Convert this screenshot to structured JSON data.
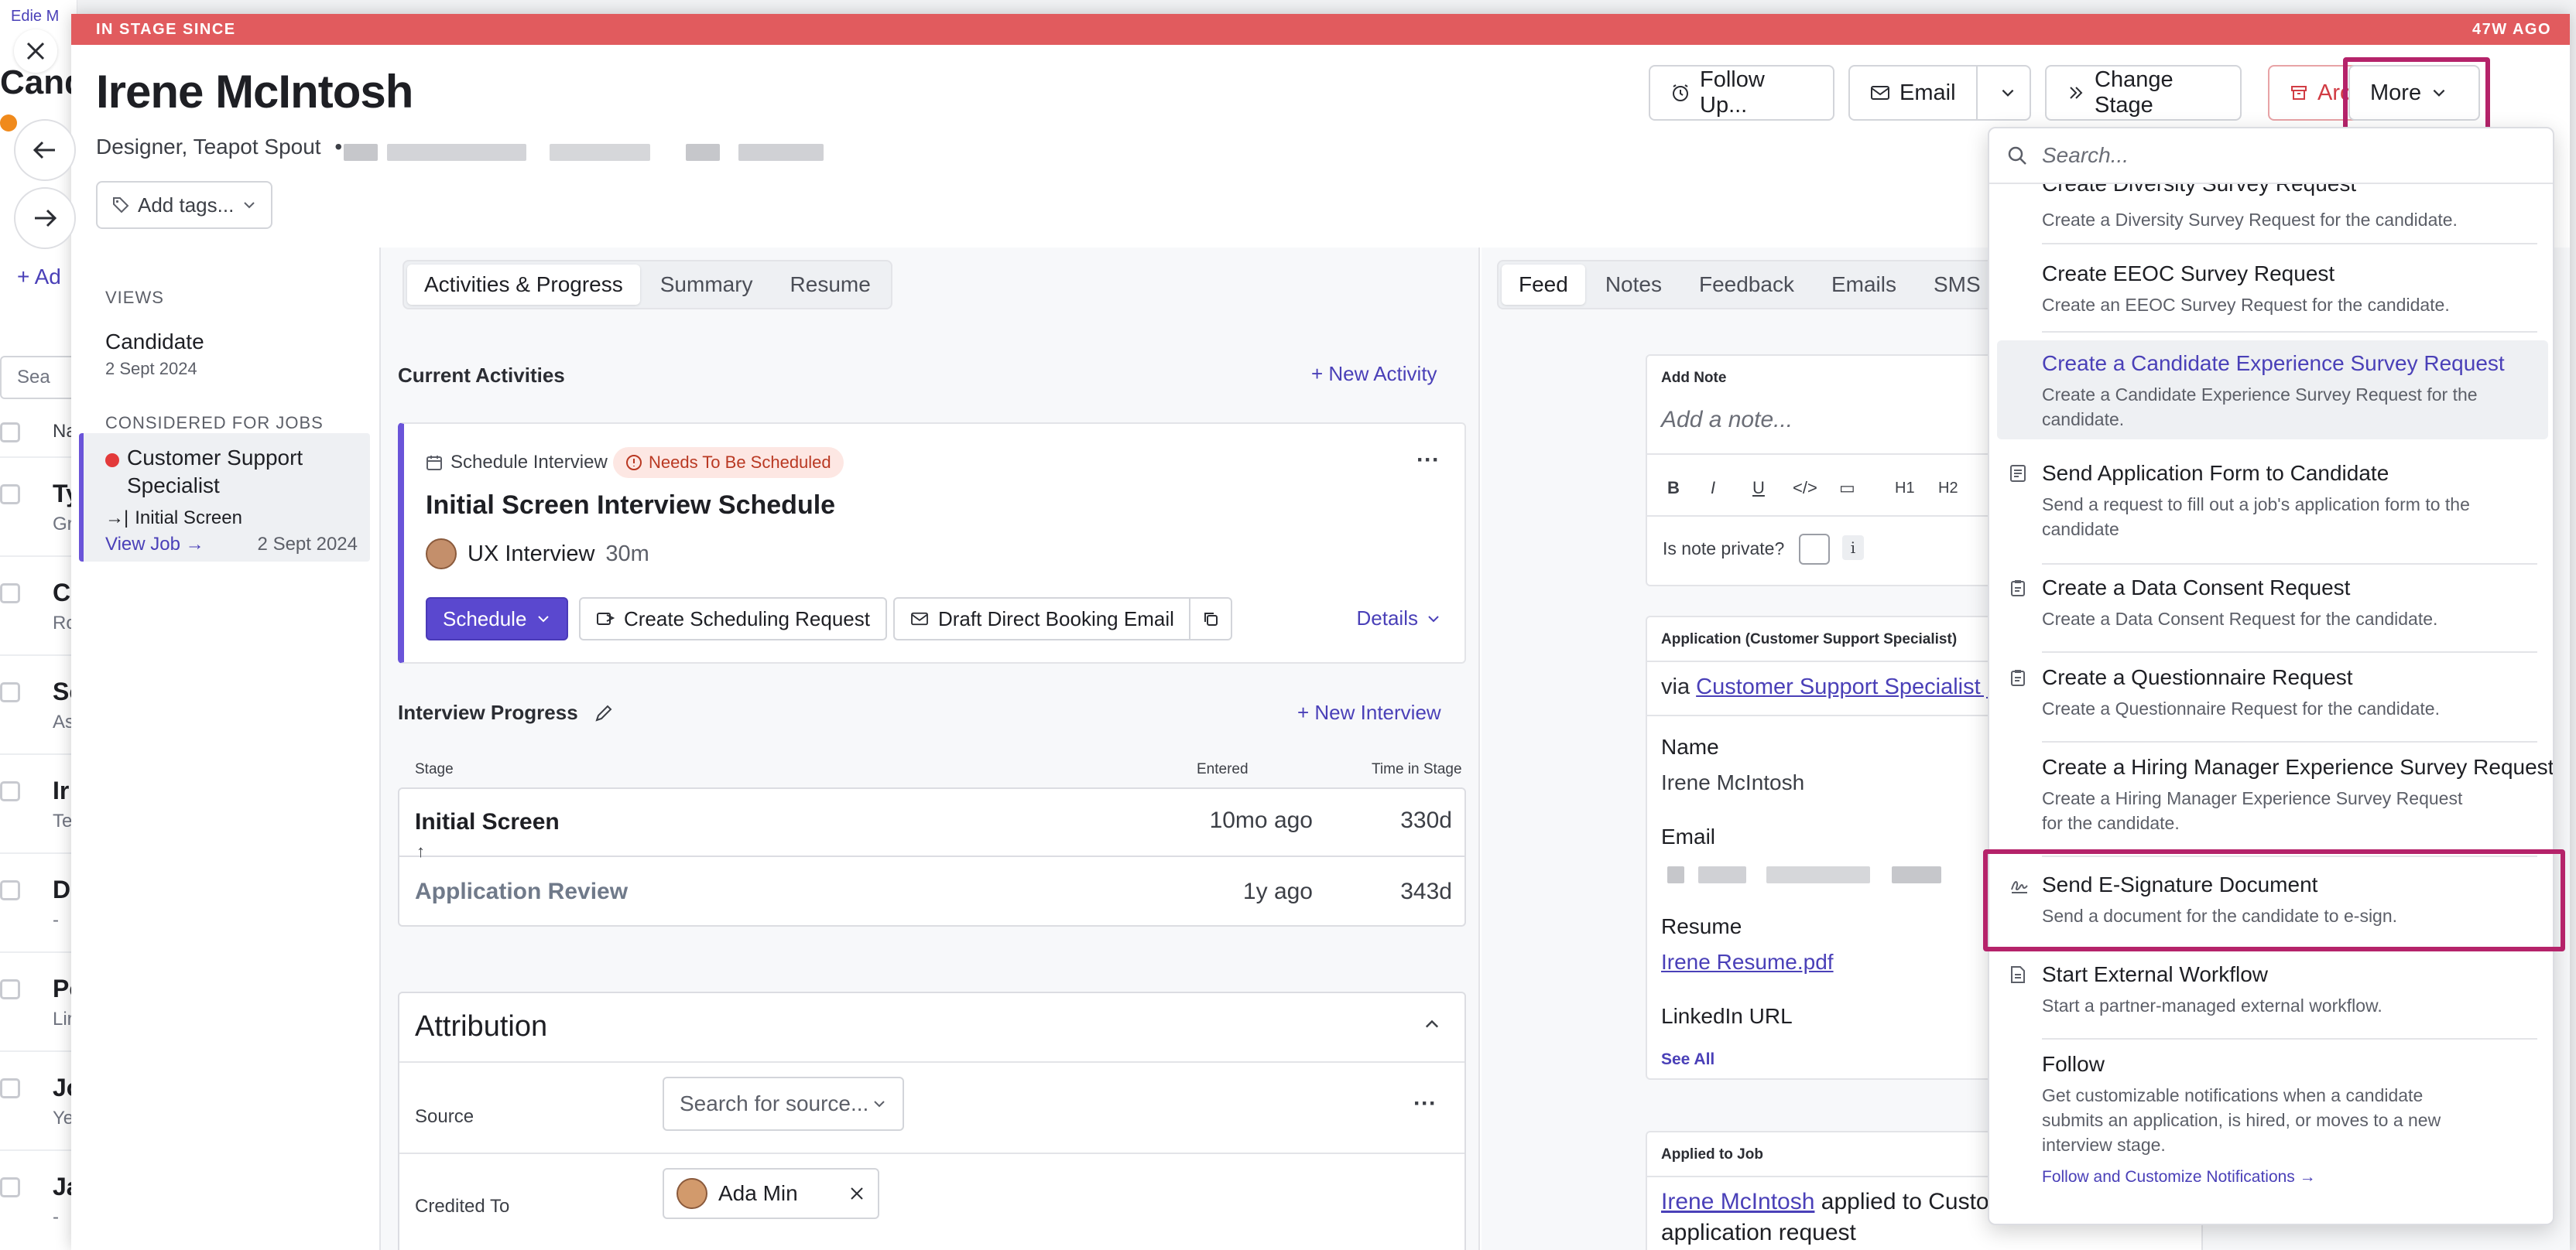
{
  "background": {
    "top_link": "Edie M",
    "header_fragment": "Cand",
    "add_label": "+ Ad",
    "search_fragment": "Sea",
    "col_fragment": "Na",
    "rows": [
      {
        "letter": "Ty",
        "sub": "Gr"
      },
      {
        "letter": "C",
        "sub": "Ro"
      },
      {
        "letter": "Sc",
        "sub": "As"
      },
      {
        "letter": "Ir",
        "sub": "Te"
      },
      {
        "letter": "D",
        "sub": "-"
      },
      {
        "letter": "Pe",
        "sub": "Lir"
      },
      {
        "letter": "Jo",
        "sub": "Ye"
      },
      {
        "letter": "Ja",
        "sub": "-"
      }
    ]
  },
  "stage_bar": {
    "left": "IN STAGE SINCE",
    "right": "47W AGO"
  },
  "candidate": {
    "name": "Irene McIntosh",
    "title": "Designer, Teapot Spout",
    "bullet": "•",
    "add_tags": "Add tags..."
  },
  "header_buttons": {
    "follow_up": "Follow Up...",
    "email": "Email",
    "change_stage": "Change Stage",
    "archive": "Archive",
    "more": "More"
  },
  "views": {
    "heading": "VIEWS",
    "candidate": "Candidate",
    "candidate_date": "2 Sept 2024",
    "considered_heading": "CONSIDERED FOR JOBS",
    "job_title_line1": "Customer Support",
    "job_title_line2": "Specialist",
    "job_stage": "Initial Screen",
    "view_job": "View Job →",
    "job_date": "2 Sept 2024"
  },
  "middle": {
    "tabs": [
      "Activities & Progress",
      "Summary",
      "Resume"
    ],
    "current_activities": "Current Activities",
    "new_activity": "+ New Activity",
    "activity": {
      "type": "Schedule Interview",
      "status": "Needs To Be Scheduled",
      "title": "Initial Screen Interview Schedule",
      "interview_name": "UX Interview",
      "duration": "30m",
      "schedule": "Schedule",
      "create_request": "Create Scheduling Request",
      "draft_email": "Draft Direct Booking Email",
      "details": "Details",
      "more": "···"
    },
    "progress": {
      "title": "Interview Progress",
      "new_interview": "+ New Interview",
      "headers": {
        "stage": "Stage",
        "entered": "Entered",
        "time": "Time in Stage"
      },
      "rows": [
        {
          "stage": "Initial Screen",
          "entered": "10mo ago",
          "time": "330d"
        },
        {
          "stage": "Application Review",
          "entered": "1y ago",
          "time": "343d"
        }
      ]
    },
    "attribution": {
      "title": "Attribution",
      "source_label": "Source",
      "source_placeholder": "Search for source...",
      "credited_label": "Credited To",
      "credited_name": "Ada Min",
      "more": "···"
    }
  },
  "feed": {
    "tabs": [
      "Feed",
      "Notes",
      "Feedback",
      "Emails",
      "SMS"
    ],
    "add_note_label": "Add Note",
    "add_note_placeholder": "Add a note...",
    "format_buttons": [
      "B",
      "I",
      "U",
      "</>",
      "▭",
      "H1",
      "H2"
    ],
    "private_label": "Is note private?",
    "info": "i",
    "application": {
      "title": "Application (Customer Support Specialist)",
      "via": "via ",
      "via_link": "Customer Support Specialist job",
      "name_label": "Name",
      "name_value": "Irene McIntosh",
      "email_label": "Email",
      "resume_label": "Resume",
      "resume_link": "Irene Resume.pdf",
      "linkedin_label": "LinkedIn URL",
      "see_all": "See All"
    },
    "applied": {
      "title": "Applied to Job",
      "name_link": "Irene McIntosh",
      "text": " applied to Custo",
      "text2": "application request"
    }
  },
  "dropdown": {
    "search_placeholder": "Search...",
    "items": [
      {
        "title": "Create Diversity Survey Request",
        "desc": "Create a Diversity Survey Request for the candidate.",
        "icon": ""
      },
      {
        "title": "Create EEOC Survey Request",
        "desc": "Create an EEOC Survey Request for the candidate.",
        "icon": ""
      },
      {
        "title": "Create a Candidate Experience Survey Request",
        "desc": "Create a Candidate Experience Survey Request for the candidate.",
        "icon": ""
      },
      {
        "title": "Send Application Form to Candidate",
        "desc": "Send a request to fill out a job's application form to the candidate",
        "icon": "form-icon"
      },
      {
        "title": "Create a Data Consent Request",
        "desc": "Create a Data Consent Request for the candidate.",
        "icon": "clipboard-icon"
      },
      {
        "title": "Create a Questionnaire Request",
        "desc": "Create a Questionnaire Request for the candidate.",
        "icon": "clipboard-icon"
      },
      {
        "title": "Create a Hiring Manager Experience Survey Request",
        "desc": "Create a Hiring Manager Experience Survey Request for the candidate.",
        "icon": ""
      },
      {
        "title": "Send E-Signature Document",
        "desc": "Send a document for the candidate to e-sign.",
        "icon": "signature-icon"
      },
      {
        "title": "Start External Workflow",
        "desc": "Start a partner-managed external workflow.",
        "icon": "document-icon"
      },
      {
        "title": "Follow",
        "desc": "Get customizable notifications when a candidate submits an application, is hired, or moves to a new interview stage.",
        "icon": ""
      }
    ],
    "follow_link": "Follow and Customize Notifications →"
  },
  "colors": {
    "stage_bar": "#e15b5e",
    "primary": "#5a48cf",
    "highlight": "#b5236a",
    "archive": "#d13c44"
  }
}
